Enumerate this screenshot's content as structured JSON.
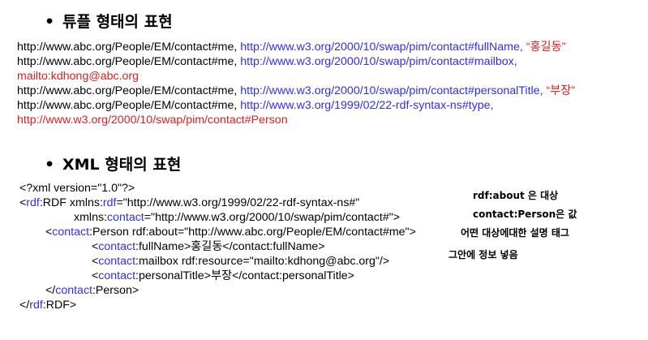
{
  "section1": {
    "bullet": "•",
    "title": "튜플 형태의 표현",
    "rows": [
      {
        "subject": "http://www.abc.org/People/EM/contact#me,",
        "predicate": "http://www.w3.org/2000/10/swap/pim/contact#fullName,",
        "object": "“홍길동”"
      },
      {
        "subject": "http://www.abc.org/People/EM/contact#me,",
        "predicate": "http://www.w3.org/2000/10/swap/pim/contact#mailbox,",
        "object": "mailto:kdhong@abc.org"
      },
      {
        "subject": "http://www.abc.org/People/EM/contact#me,",
        "predicate": "http://www.w3.org/2000/10/swap/pim/contact#personalTitle,",
        "object": "“부장”"
      },
      {
        "subject": "http://www.abc.org/People/EM/contact#me,",
        "predicate": "http://www.w3.org/1999/02/22-rdf-syntax-ns#type,",
        "object": "http://www.w3.org/2000/10/swap/pim/contact#Person"
      }
    ]
  },
  "section2": {
    "bullet": "•",
    "title": "XML 형태의 표현",
    "xml": {
      "l1": "<?xml version=\"1.0\"?>",
      "l2a": "<",
      "l2b": "rdf",
      "l2c": ":RDF xmlns:",
      "l2d": "rdf",
      "l2e": "=\"http://www.w3.org/1999/02/22-rdf-syntax-ns#\"",
      "l3a": "xmlns:",
      "l3b": "contact",
      "l3c": "=\"http://www.w3.org/2000/10/swap/pim/contact#\">",
      "l4a": "<",
      "l4b": "contact",
      "l4c": ":Person rdf:about=\"http://www.abc.org/People/EM/contact#me\">",
      "l5a": "<",
      "l5b": "contact",
      "l5c": ":fullName>홍길동</contact:fullName>",
      "l6a": "<",
      "l6b": "contact",
      "l6c": ":mailbox rdf:resource=\"mailto:kdhong@abc.org\"/>",
      "l7a": "<",
      "l7b": "contact",
      "l7c": ":personalTitle>부장</contact:personalTitle>",
      "l8a": "</",
      "l8b": "contact",
      "l8c": ":Person>",
      "l9a": "</",
      "l9b": "rdf",
      "l9c": ":RDF>"
    },
    "notes": [
      "rdf:about 은 대상",
      "contact:Person은 값",
      "어떤 대상에대한 설명 태그",
      "그안에 정보 넣음"
    ]
  }
}
